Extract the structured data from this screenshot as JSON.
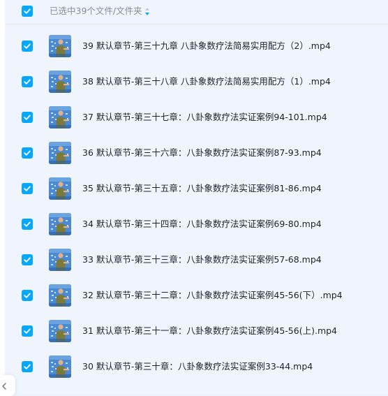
{
  "header": {
    "checked": true,
    "selection_text": "已选中39个文件/文件夹"
  },
  "files": [
    {
      "name": "39 默认章节-第三十九章 八卦象数疗法简易实用配方（2）.mp4",
      "checked": true
    },
    {
      "name": "38 默认章节-第三十八章 八卦象数疗法简易实用配方（1）.mp4",
      "checked": true
    },
    {
      "name": "37 默认章节-第三十七章：八卦象数疗法实证案例94-101.mp4",
      "checked": true
    },
    {
      "name": "36 默认章节-第三十六章：八卦象数疗法实证案例87-93.mp4",
      "checked": true
    },
    {
      "name": "35 默认章节-第三十五章：八卦象数疗法实证案例81-86.mp4",
      "checked": true
    },
    {
      "name": "34 默认章节-第三十四章：八卦象数疗法实证案例69-80.mp4",
      "checked": true
    },
    {
      "name": "33 默认章节-第三十三章：八卦象数疗法实证案例57-68.mp4",
      "checked": true
    },
    {
      "name": "32 默认章节-第三十二章：八卦象数疗法实证案例45-56(下）.mp4",
      "checked": true
    },
    {
      "name": "31 默认章节-第三十一章：八卦象数疗法实证案例45-56(上).mp4",
      "checked": true
    },
    {
      "name": "30 默认章节-第三十章：八卦象数疗法实证案例33-44.mp4",
      "checked": true
    }
  ],
  "icons": {
    "checkbox": "checkmark-icon",
    "sort": "sort-icon",
    "thumbnail": "video-thumbnail",
    "back": "chevron-left-icon"
  },
  "colors": {
    "accent": "#06a7ff",
    "background": "#f0f5fd",
    "text": "#1f2329",
    "muted_text": "#878c9c"
  }
}
